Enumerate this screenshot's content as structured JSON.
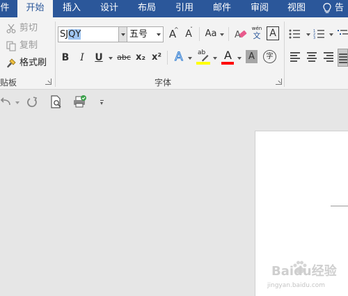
{
  "tabs": [
    {
      "label": "开始",
      "active": true
    },
    {
      "label": "插入",
      "active": false
    },
    {
      "label": "设计",
      "active": false
    },
    {
      "label": "布局",
      "active": false
    },
    {
      "label": "引用",
      "active": false
    },
    {
      "label": "邮件",
      "active": false
    },
    {
      "label": "审阅",
      "active": false
    },
    {
      "label": "视图",
      "active": false
    }
  ],
  "tab_partial_left": "件",
  "tell_me": "告",
  "clipboard": {
    "cut_label": "剪切",
    "copy_label": "复制",
    "format_painter_label": "格式刷",
    "group_label": "贴板"
  },
  "font": {
    "font_name_prefix": "SJ",
    "font_name_selected": "QY",
    "font_size": "五号",
    "group_label": "字体",
    "grow_label": "A",
    "shrink_label": "A",
    "case_label": "Aa",
    "phonetic_top": "wén",
    "phonetic_bottom": "文",
    "border_label": "A",
    "bold_label": "B",
    "italic_label": "I",
    "underline_label": "U",
    "strike_label": "abc",
    "subscript_label": "x₂",
    "superscript_label": "x²",
    "effects_label": "A",
    "highlight_label": "ab",
    "color_label": "A",
    "shading_label": "A",
    "enclose_label": "字"
  },
  "colors": {
    "brand_blue": "#2b579a",
    "ribbon_bg": "#f3f3f3",
    "highlight_yellow": "#ffff00",
    "font_red": "#ff0000",
    "selection": "#9fc5f2"
  },
  "watermark": {
    "text": "Baidu经验",
    "url": "jingyan.baidu.com"
  }
}
